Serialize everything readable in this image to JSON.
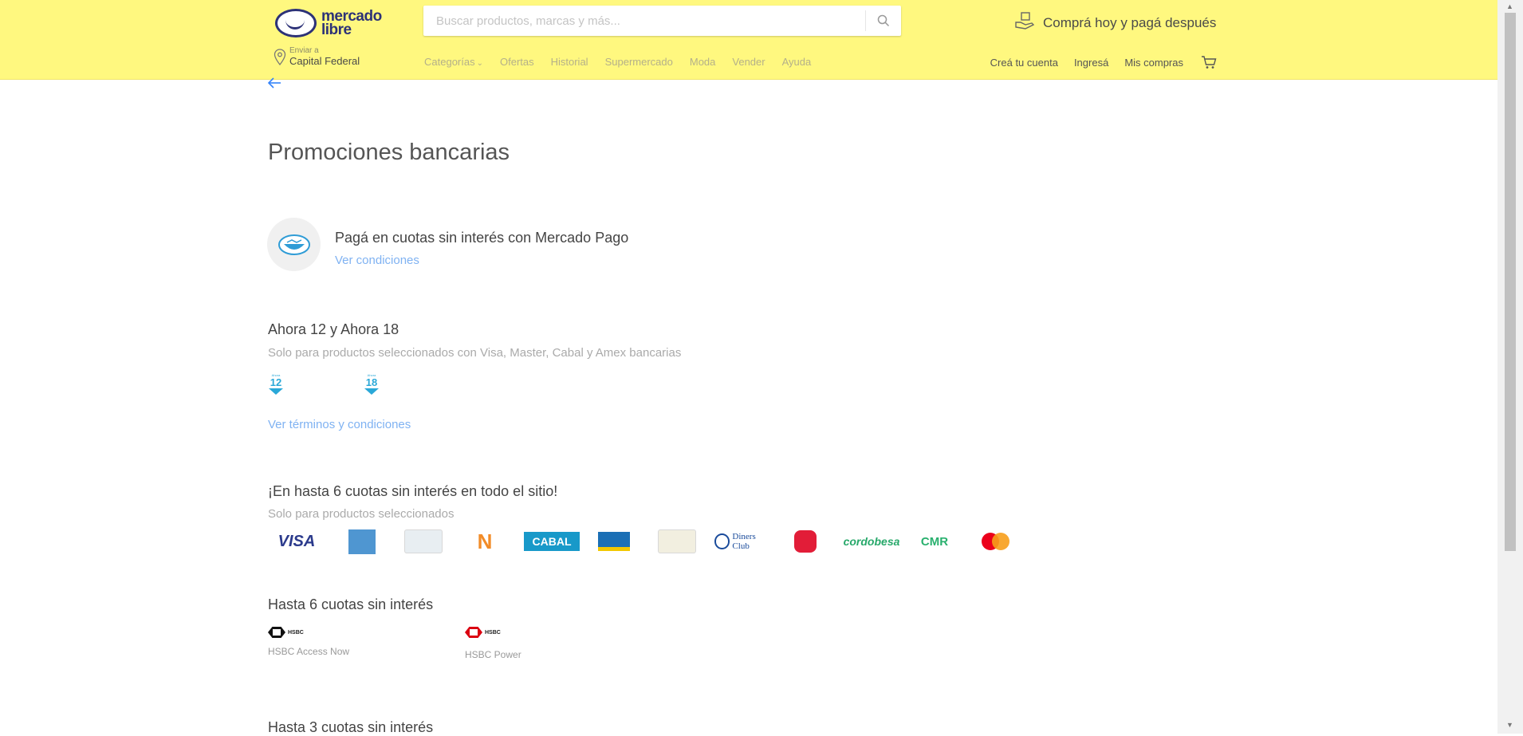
{
  "header": {
    "logo_text": "mercado libre",
    "search_placeholder": "Buscar productos, marcas y más...",
    "promo_text": "Comprá hoy y pagá después",
    "location_label": "Enviar a",
    "location_value": "Capital Federal",
    "nav": [
      "Categorías",
      "Ofertas",
      "Historial",
      "Supermercado",
      "Moda",
      "Vender",
      "Ayuda"
    ],
    "account_links": [
      "Creá tu cuenta",
      "Ingresá",
      "Mis compras"
    ],
    "colors": {
      "header_bg": "#fff87f",
      "brand_blue": "#2d3277",
      "link": "#3483fa"
    }
  },
  "page_title": "Promociones bancarias",
  "mercadopago": {
    "title": "Pagá en cuotas sin interés con Mercado Pago",
    "link": "Ver condiciones"
  },
  "ahora": {
    "title": "Ahora 12 y Ahora 18",
    "subtitle": "Solo para productos seleccionados con Visa, Master, Cabal y Amex bancarias",
    "badges": [
      {
        "tiny": "Ahora",
        "num": "12"
      },
      {
        "tiny": "Ahora",
        "num": "18"
      }
    ],
    "link": "Ver términos y condiciones"
  },
  "six_site": {
    "title": "¡En hasta 6 cuotas sin interés en todo el sitio!",
    "subtitle": "Solo para productos seleccionados",
    "cards": [
      {
        "name": "visa",
        "text": "VISA"
      },
      {
        "name": "amex",
        "text": ""
      },
      {
        "name": "generic-card-1",
        "text": ""
      },
      {
        "name": "naranja",
        "text": "N"
      },
      {
        "name": "cabal",
        "text": "CABAL"
      },
      {
        "name": "nativa",
        "text": ""
      },
      {
        "name": "generic-card-2",
        "text": ""
      },
      {
        "name": "diners",
        "text": "Diners Club"
      },
      {
        "name": "argencard",
        "text": ""
      },
      {
        "name": "cordobesa",
        "text": "cordobesa"
      },
      {
        "name": "cmr",
        "text": "CMR"
      },
      {
        "name": "mastercard",
        "text": ""
      }
    ]
  },
  "six": {
    "title": "Hasta 6 cuotas sin interés",
    "banks": [
      {
        "logo": "HSBC",
        "label": "HSBC Access Now"
      },
      {
        "logo": "HSBC",
        "label": "HSBC Power"
      }
    ]
  },
  "three": {
    "title": "Hasta 3 cuotas sin interés"
  }
}
